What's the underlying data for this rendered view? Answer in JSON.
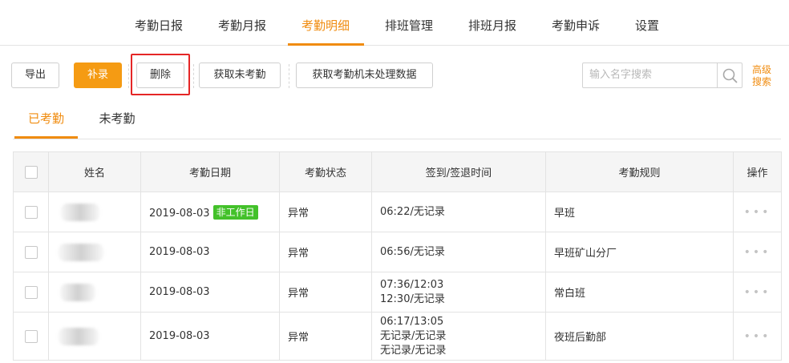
{
  "top_nav": {
    "tabs": [
      "考勤日报",
      "考勤月报",
      "考勤明细",
      "排班管理",
      "排班月报",
      "考勤申诉",
      "设置"
    ],
    "active": "考勤明细"
  },
  "toolbar": {
    "export_label": "导出",
    "supplement_label": "补录",
    "delete_label": "删除",
    "fetch_absent_label": "获取未考勤",
    "fetch_machine_label": "获取考勤机未处理数据",
    "search_placeholder": "输入名字搜索",
    "advanced_search_label_1": "高级",
    "advanced_search_label_2": "搜索"
  },
  "sub_tabs": {
    "attended": "已考勤",
    "not_attended": "未考勤",
    "active": "已考勤"
  },
  "table": {
    "headers": {
      "name": "姓名",
      "date": "考勤日期",
      "status": "考勤状态",
      "signin": "签到/签退时间",
      "rule": "考勤规则",
      "actions": "操作"
    },
    "rows": [
      {
        "date": "2019-08-03",
        "badge": "非工作日",
        "status": "异常",
        "signin": [
          "06:22/无记录"
        ],
        "rule": "早班",
        "actions": "•••"
      },
      {
        "date": "2019-08-03",
        "status": "异常",
        "signin": [
          "06:56/无记录"
        ],
        "rule": "早班矿山分厂",
        "actions": "•••"
      },
      {
        "date": "2019-08-03",
        "status": "异常",
        "signin": [
          "07:36/12:03",
          "12:30/无记录"
        ],
        "rule": "常白班",
        "actions": "•••"
      },
      {
        "date": "2019-08-03",
        "status": "异常",
        "signin": [
          "06:17/13:05",
          "无记录/无记录",
          "无记录/无记录"
        ],
        "rule": "夜班后勤部",
        "actions": "•••"
      }
    ]
  },
  "colors": {
    "accent": "#f08c10",
    "primary_button": "#f59b13",
    "badge_green": "#43c12a",
    "highlight_red": "#e52626"
  }
}
